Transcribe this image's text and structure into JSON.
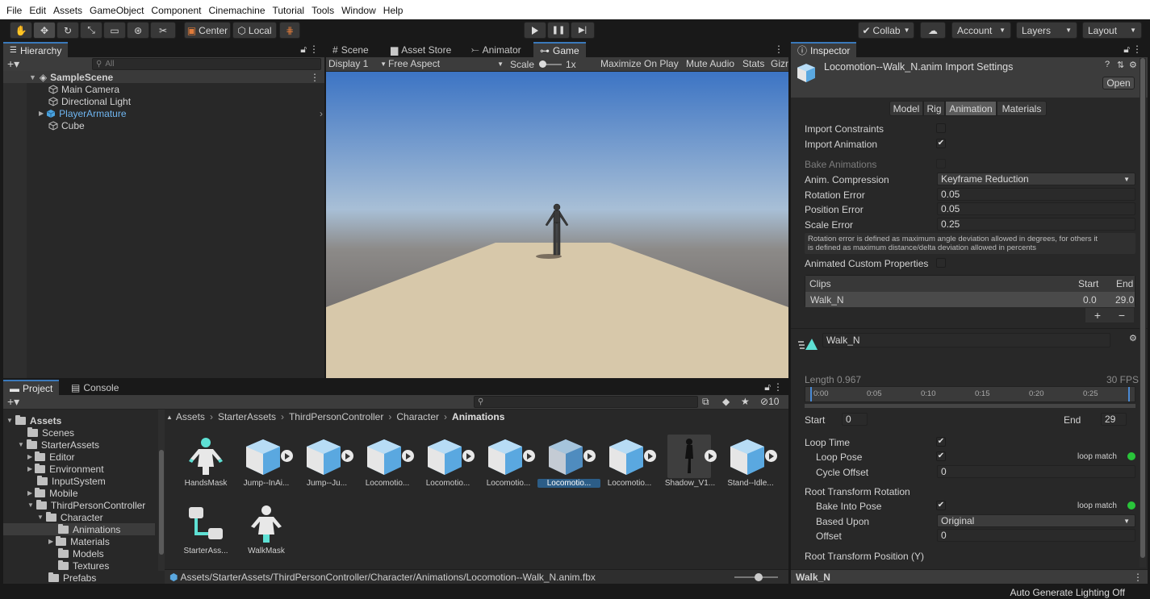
{
  "menu": [
    "File",
    "Edit",
    "Assets",
    "GameObject",
    "Component",
    "Cinemachine",
    "Tutorial",
    "Tools",
    "Window",
    "Help"
  ],
  "toolbar": {
    "center_label": "Center",
    "local_label": "Local",
    "collab_label": "Collab",
    "account_label": "Account",
    "layers_label": "Layers",
    "layout_label": "Layout"
  },
  "hierarchy": {
    "tab_label": "Hierarchy",
    "search_placeholder": "All",
    "scene": "SampleScene",
    "items": [
      "Main Camera",
      "Directional Light",
      "PlayerArmature",
      "Cube"
    ]
  },
  "scene_tabs": [
    "Scene",
    "Asset Store",
    "Animator",
    "Game"
  ],
  "game_bar": {
    "display": "Display 1",
    "aspect": "Free Aspect",
    "scale_label": "Scale",
    "scale_value": "1x",
    "maximize": "Maximize On Play",
    "mute": "Mute Audio",
    "stats": "Stats",
    "gizmos": "Gizr"
  },
  "project": {
    "tab_project": "Project",
    "tab_console": "Console",
    "hidden_count": "10",
    "breadcrumb": [
      "Assets",
      "StarterAssets",
      "ThirdPersonController",
      "Character",
      "Animations"
    ],
    "tree": [
      {
        "label": "Assets",
        "bold": true
      },
      {
        "label": "Scenes"
      },
      {
        "label": "StarterAssets"
      },
      {
        "label": "Editor"
      },
      {
        "label": "Environment"
      },
      {
        "label": "InputSystem"
      },
      {
        "label": "Mobile"
      },
      {
        "label": "ThirdPersonController"
      },
      {
        "label": "Character"
      },
      {
        "label": "Animations"
      },
      {
        "label": "Materials"
      },
      {
        "label": "Models"
      },
      {
        "label": "Textures"
      },
      {
        "label": "Prefabs"
      }
    ],
    "assets": [
      "HandsMask",
      "Jump--InAi...",
      "Jump--Ju...",
      "Locomotio...",
      "Locomotio...",
      "Locomotio...",
      "Locomotio...",
      "Locomotio...",
      "Shadow_V1...",
      "Stand--Idle...",
      "StarterAss...",
      "WalkMask"
    ],
    "path": "Assets/StarterAssets/ThirdPersonController/Character/Animations/Locomotion--Walk_N.anim.fbx"
  },
  "inspector": {
    "tab_label": "Inspector",
    "title": "Locomotion--Walk_N.anim Import Settings",
    "open_button": "Open",
    "tabs": [
      "Model",
      "Rig",
      "Animation",
      "Materials"
    ],
    "import_constraints": "Import Constraints",
    "import_animation": "Import Animation",
    "bake_animations": "Bake Animations",
    "anim_compression_label": "Anim. Compression",
    "anim_compression_value": "Keyframe Reduction",
    "rotation_error_label": "Rotation Error",
    "rotation_error_value": "0.05",
    "position_error_label": "Position Error",
    "position_error_value": "0.05",
    "scale_error_label": "Scale Error",
    "scale_error_value": "0.25",
    "help_text_1": "Rotation error is defined as maximum angle deviation allowed in degrees, for others it",
    "help_text_2": "is defined as maximum distance/delta deviation allowed in percents",
    "animated_custom_props": "Animated Custom Properties",
    "clips_header": "Clips",
    "clips_start_header": "Start",
    "clips_end_header": "End",
    "clip_name": "Walk_N",
    "clip_start": "0.0",
    "clip_end": "29.0",
    "clip_name_field": "Walk_N",
    "length_label": "Length",
    "length_value": "0.967",
    "fps": "30 FPS",
    "timeline_ticks": [
      "0:00",
      "0:05",
      "0:10",
      "0:15",
      "0:20",
      "0:25"
    ],
    "start_label": "Start",
    "start_value": "0",
    "end_label": "End",
    "end_value": "29",
    "loop_time": "Loop Time",
    "loop_pose": "Loop Pose",
    "loop_match": "loop match",
    "cycle_offset_label": "Cycle Offset",
    "cycle_offset_value": "0",
    "root_rotation": "Root Transform Rotation",
    "bake_into_pose": "Bake Into Pose",
    "based_upon_label": "Based Upon",
    "based_upon_value": "Original",
    "offset_label": "Offset",
    "offset_value": "0",
    "root_position_y": "Root Transform Position (Y)",
    "footer_clip": "Walk_N"
  },
  "status": {
    "lighting": "Auto Generate Lighting Off"
  },
  "colors": {
    "accent": "#3a79bb",
    "selection": "#2c5d87",
    "loop_match_green": "#29c43a"
  }
}
